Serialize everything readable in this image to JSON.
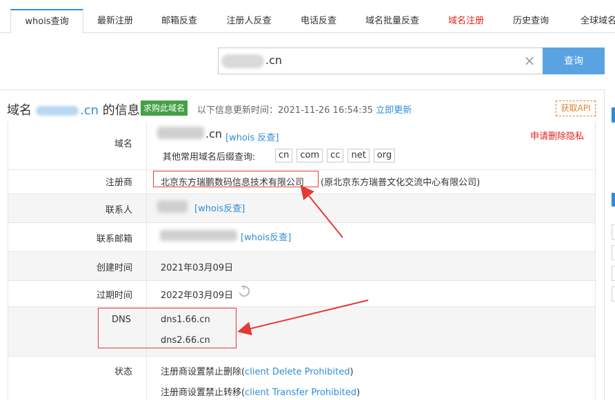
{
  "tabs": [
    {
      "label": "whois查询",
      "active": true
    },
    {
      "label": "最新注册"
    },
    {
      "label": "邮箱反查"
    },
    {
      "label": "注册人反查"
    },
    {
      "label": "电话反查"
    },
    {
      "label": "域名批量反查"
    },
    {
      "label": "域名注册",
      "color": "#e2231a"
    },
    {
      "label": "历史查询"
    },
    {
      "label": "全球域名"
    }
  ],
  "search": {
    "value_suffix": ".cn",
    "button_label": "查询",
    "clear_icon": "close-icon"
  },
  "header": {
    "title_prefix": "域名",
    "title_tld": ".cn",
    "title_suffix": " 的信息",
    "buy_badge": "求购此域名",
    "update_label": "以下信息更新时间：2021-11-26 16:54:35",
    "update_link": "立即更新",
    "api_button": "获取API"
  },
  "rows": {
    "domain": {
      "label": "域名",
      "value_tld": ".cn",
      "whois_link": "[whois 反查]",
      "delete_privacy": "申请删除隐私",
      "suffix_label": "其他常用域名后缀查询:",
      "suffixes": [
        "cn",
        "com",
        "cc",
        "net",
        "org"
      ]
    },
    "registrar": {
      "label": "注册商",
      "value": "北京东方瑞鹏数码信息技术有限公司",
      "note": "(原北京东方瑞普文化交流中心有限公司)"
    },
    "contact": {
      "label": "联系人",
      "whois_link": "[whois反查]"
    },
    "email": {
      "label": "联系邮箱",
      "whois_link": "[whois反查]"
    },
    "created": {
      "label": "创建时间",
      "value": "2021年03月09日"
    },
    "expires": {
      "label": "过期时间",
      "value": "2022年03月09日",
      "refresh_icon": "refresh-icon"
    },
    "dns": {
      "label": "DNS",
      "values": [
        "dns1.66.cn",
        "dns2.66.cn"
      ]
    },
    "status": {
      "label": "状态",
      "items": [
        {
          "text": "注册商设置禁止删除(",
          "code": "client Delete Prohibited",
          "close": ")"
        },
        {
          "text": "注册商设置禁止转移(",
          "code": "client Transfer Prohibited",
          "close": ")"
        }
      ]
    }
  },
  "colors": {
    "accent": "#2e8ddb",
    "search_button": "#5aa3e3",
    "badge_green": "#43a047",
    "annotation_red": "#e53935",
    "api_orange": "#e37f2b"
  }
}
